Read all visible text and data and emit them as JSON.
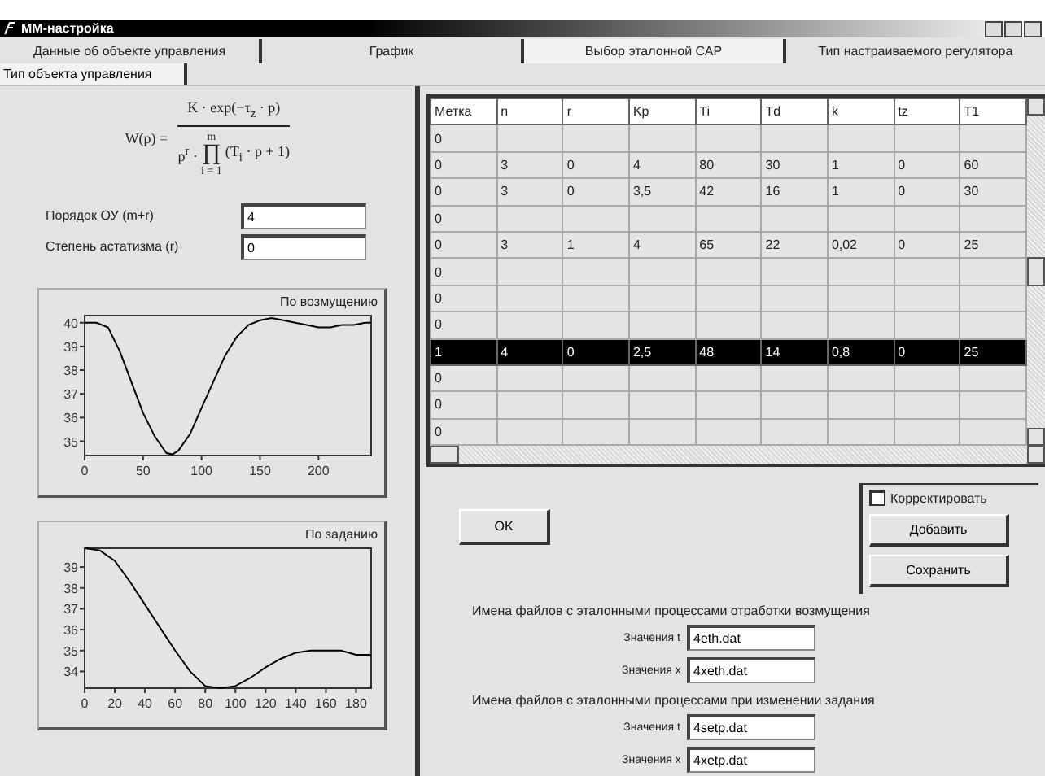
{
  "window": {
    "title": "MM-настройка"
  },
  "tabs": [
    {
      "label": "Данные об объекте управления",
      "selected": false
    },
    {
      "label": "График",
      "selected": false
    },
    {
      "label": "Выбор эталонной САР",
      "selected": true
    },
    {
      "label": "Тип настраиваемого регулятора",
      "selected": false
    }
  ],
  "subtabs": [
    {
      "label": "Тип объекта управления",
      "selected": true
    }
  ],
  "formula": {
    "lhs": "W(p) =",
    "numerator": "K · exp(−τ$_{z}$ · p)",
    "denominator_left": "p$^{r}$ ·",
    "product": "∏",
    "denominator_right": "(T$_{i}$ · p + 1)",
    "upper": "m",
    "lower": "i = 1"
  },
  "fields": [
    {
      "label": "Порядок ОУ (m+r)",
      "value": "4"
    },
    {
      "label": "Степень астатизма (r)",
      "value": "0"
    }
  ],
  "charts": [
    {
      "chart_data": {
        "type": "line",
        "title": "По возмущению",
        "xlim": [
          0,
          245
        ],
        "ylim": [
          34.4,
          40.3
        ],
        "xticks": [
          0,
          50,
          100,
          150,
          200
        ],
        "yticks": [
          35,
          36,
          37,
          38,
          39,
          40
        ],
        "x": [
          0,
          10,
          20,
          30,
          40,
          50,
          60,
          70,
          75,
          80,
          90,
          100,
          110,
          120,
          130,
          140,
          150,
          160,
          170,
          180,
          190,
          200,
          210,
          220,
          230,
          240,
          245
        ],
        "series": [
          {
            "color": "#000000",
            "values": [
              40,
              40,
              39.8,
              38.8,
              37.5,
              36.2,
              35.2,
              34.5,
              34.45,
              34.6,
              35.3,
              36.4,
              37.5,
              38.6,
              39.4,
              39.9,
              40.1,
              40.2,
              40.1,
              40,
              39.9,
              39.8,
              39.8,
              39.9,
              39.9,
              40,
              40
            ]
          }
        ]
      }
    },
    {
      "chart_data": {
        "type": "line",
        "title": "По заданию",
        "xlim": [
          0,
          190
        ],
        "ylim": [
          33.2,
          39.9
        ],
        "xticks": [
          0,
          20,
          40,
          60,
          80,
          100,
          120,
          140,
          160,
          180
        ],
        "yticks": [
          34,
          35,
          36,
          37,
          38,
          39
        ],
        "x": [
          0,
          10,
          20,
          30,
          40,
          50,
          60,
          70,
          80,
          90,
          100,
          110,
          120,
          130,
          140,
          150,
          160,
          170,
          180,
          190
        ],
        "series": [
          {
            "color": "#000000",
            "values": [
              39.9,
              39.8,
              39.3,
              38.3,
              37.2,
              36.1,
              35,
              34,
              33.3,
              33.2,
              33.3,
              33.7,
              34.2,
              34.6,
              34.9,
              35,
              35,
              35,
              34.8,
              34.8
            ]
          }
        ]
      }
    }
  ],
  "table": {
    "columns": [
      "Метка",
      "n",
      "r",
      "Kp",
      "Ti",
      "Td",
      "k",
      "tz",
      "T1"
    ],
    "rows": [
      {
        "cells": [
          "0"
        ],
        "selected": false
      },
      {
        "cells": [
          "0",
          "3",
          "0",
          "4",
          "80",
          "30",
          "1",
          "0",
          "60"
        ],
        "selected": false
      },
      {
        "cells": [
          "0",
          "3",
          "0",
          "3,5",
          "42",
          "16",
          "1",
          "0",
          "30"
        ],
        "selected": false
      },
      {
        "cells": [
          "0"
        ],
        "selected": false
      },
      {
        "cells": [
          "0",
          "3",
          "1",
          "4",
          "65",
          "22",
          "0,02",
          "0",
          "25"
        ],
        "selected": false
      },
      {
        "cells": [
          "0"
        ],
        "selected": false
      },
      {
        "cells": [
          "0"
        ],
        "selected": false
      },
      {
        "cells": [
          "0"
        ],
        "selected": false
      },
      {
        "cells": [
          "1",
          "4",
          "0",
          "2,5",
          "48",
          "14",
          "0,8",
          "0",
          "25"
        ],
        "selected": true
      },
      {
        "cells": [
          "0"
        ],
        "selected": false
      },
      {
        "cells": [
          "0"
        ],
        "selected": false
      },
      {
        "cells": [
          "0"
        ],
        "selected": false
      }
    ]
  },
  "ok_button": "OK",
  "group": {
    "checkbox": {
      "label": "Корректировать",
      "checked": false
    },
    "buttons": [
      "Добавить",
      "Сохранить"
    ]
  },
  "file_sections": [
    {
      "heading": "Имена файлов с эталонными процессами отработки возмущения",
      "fields": [
        {
          "label": "Значения t",
          "value": "4eth.dat"
        },
        {
          "label": "Значения x",
          "value": "4xeth.dat"
        }
      ]
    },
    {
      "heading": "Имена файлов с эталонными процессами при изменении задания",
      "fields": [
        {
          "label": "Значения t",
          "value": "4setp.dat"
        },
        {
          "label": "Значения x",
          "value": "4xetp.dat"
        }
      ]
    }
  ]
}
